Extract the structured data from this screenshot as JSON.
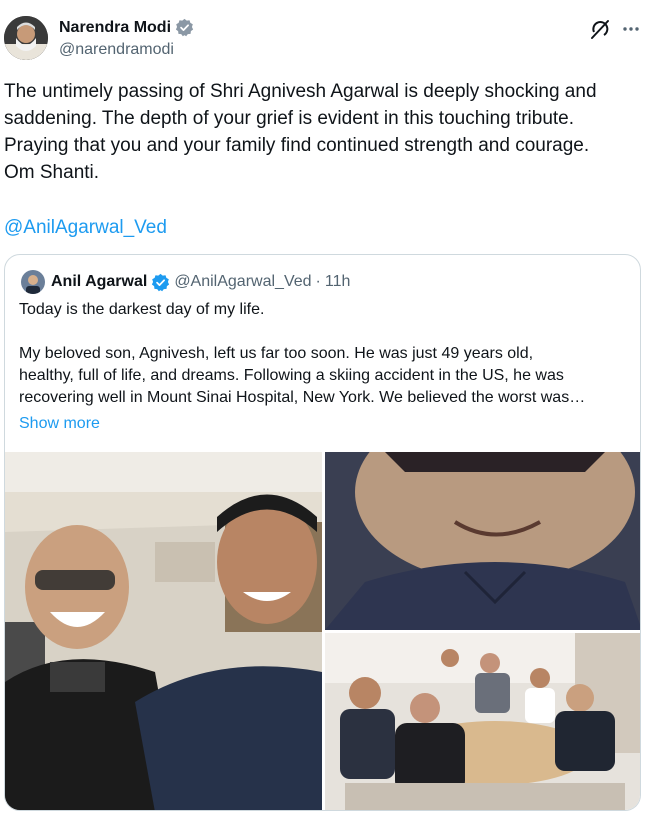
{
  "tweet": {
    "author": {
      "name": "Narendra Modi",
      "handle": "@narendramodi"
    },
    "text": "The untimely passing of Shri Agnivesh Agarwal is deeply shocking and\nsaddening. The depth of your grief is evident in this touching tribute.\nPraying that you and your family find continued strength and courage.\nOm Shanti.",
    "mention": "@AnilAgarwal_Ved",
    "icons": [
      "verified-badge-icon",
      "grok-icon",
      "more-icon"
    ],
    "colors": {
      "link": "#1d9bf0",
      "secondary_text": "#536471",
      "verified": "#1d9bf0"
    }
  },
  "quote": {
    "author": {
      "name": "Anil Agarwal",
      "handle": "@AnilAgarwal_Ved",
      "separator": "·",
      "time": "11h"
    },
    "text": "Today is the darkest day of my life.\n\nMy beloved son, Agnivesh, left us far too soon. He was just 49 years old,\nhealthy, full of life, and dreams. Following a skiing accident in the US, he was\nrecovering well in Mount Sinai Hospital, New York. We believed the worst was…",
    "show_more": "Show more"
  }
}
